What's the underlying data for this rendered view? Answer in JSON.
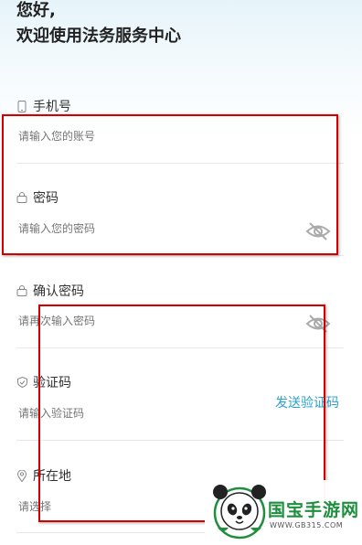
{
  "greeting": {
    "line1": "您好,",
    "line2": "欢迎使用法务服务中心"
  },
  "fields": [
    {
      "label": "手机号",
      "placeholder": "请输入您的账号",
      "icon": "phone-icon"
    },
    {
      "label": "密码",
      "placeholder": "请输入您的密码",
      "icon": "lock-icon"
    },
    {
      "label": "确认密码",
      "placeholder": "请再次输入密码",
      "icon": "lock-icon"
    },
    {
      "label": "验证码",
      "placeholder": "请输入验证码",
      "icon": "shield-icon",
      "action": "发送验证码"
    },
    {
      "label": "所在地",
      "placeholder": "请选择",
      "icon": "location-pin-icon"
    }
  ],
  "watermark": {
    "title": "国宝手游网",
    "url": "WWW.GB315.COM"
  },
  "colors": {
    "accent": "#2aa1d0",
    "annotation": "#d40000",
    "watermark_green": "#1f8f3f"
  }
}
